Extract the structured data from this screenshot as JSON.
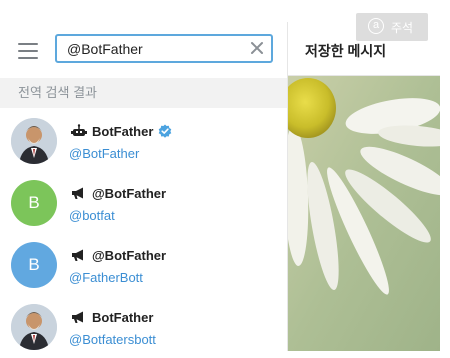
{
  "search": {
    "value": "@BotFather",
    "clear_icon": "close-icon"
  },
  "left": {
    "menu_icon": "hamburger-icon",
    "section_title": "전역 검색 결과",
    "results": [
      {
        "name": "BotFather",
        "handle": "@BotFather",
        "type_icon": "bot-icon",
        "verified": true,
        "avatar": "botfather-avatar"
      },
      {
        "name": "@BotFather",
        "handle": "@botfat",
        "type_icon": "channel-icon",
        "verified": false,
        "avatar_letter": "B",
        "avatar_color": "#7cc55a"
      },
      {
        "name": "@BotFather",
        "handle": "@FatherBott",
        "type_icon": "channel-icon",
        "verified": false,
        "avatar_letter": "B",
        "avatar_color": "#61a8e0"
      },
      {
        "name": "BotFather",
        "handle": "@Botfatersbott",
        "type_icon": "channel-icon",
        "verified": false,
        "avatar": "botfather-avatar"
      }
    ]
  },
  "right": {
    "title": "저장한 메시지"
  },
  "overlay": {
    "label": "주석",
    "icon_letter": "a"
  },
  "colors": {
    "accent": "#5da8dd",
    "link": "#3b8ed3",
    "verified": "#4ca3e0"
  }
}
